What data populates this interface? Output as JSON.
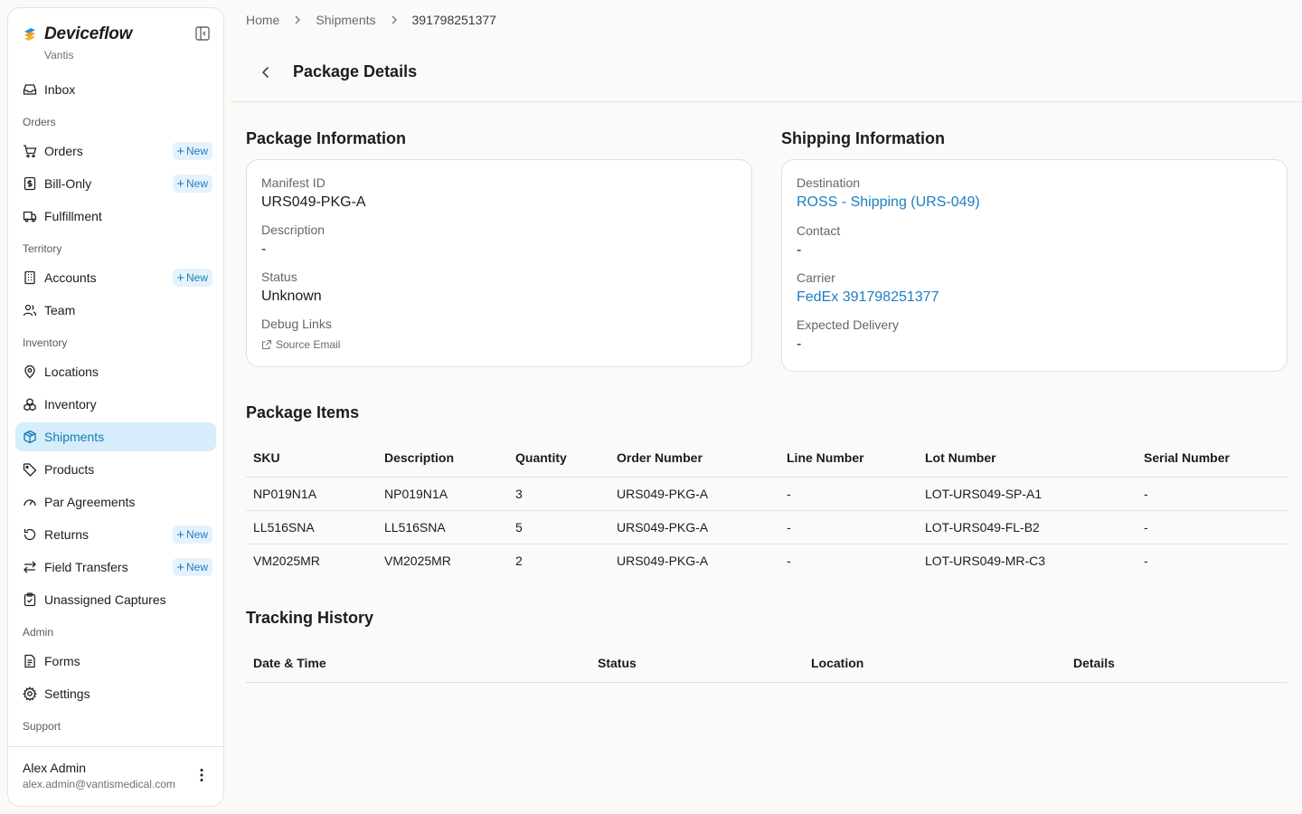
{
  "brand": {
    "name": "Deviceflow",
    "org": "Vantis"
  },
  "nav": {
    "inbox": "Inbox",
    "sections": {
      "orders": "Orders",
      "territory": "Territory",
      "inventory": "Inventory",
      "admin": "Admin",
      "support": "Support"
    },
    "items": {
      "orders": "Orders",
      "bill_only": "Bill-Only",
      "fulfillment": "Fulfillment",
      "accounts": "Accounts",
      "team": "Team",
      "locations": "Locations",
      "inventory": "Inventory",
      "shipments": "Shipments",
      "products": "Products",
      "par_agreements": "Par Agreements",
      "returns": "Returns",
      "field_transfers": "Field Transfers",
      "unassigned_captures": "Unassigned Captures",
      "forms": "Forms",
      "settings": "Settings"
    },
    "new_label": "New",
    "active": "Shipments"
  },
  "user": {
    "name": "Alex Admin",
    "email": "alex.admin@vantismedical.com"
  },
  "breadcrumb": {
    "home": "Home",
    "shipments": "Shipments",
    "current": "391798251377"
  },
  "page": {
    "title": "Package Details"
  },
  "package_info": {
    "title": "Package Information",
    "manifest_label": "Manifest ID",
    "manifest_value": "URS049-PKG-A",
    "description_label": "Description",
    "description_value": "-",
    "status_label": "Status",
    "status_value": "Unknown",
    "debug_label": "Debug Links",
    "source_email": "Source Email"
  },
  "shipping_info": {
    "title": "Shipping Information",
    "destination_label": "Destination",
    "destination_value": "ROSS - Shipping (URS-049)",
    "contact_label": "Contact",
    "contact_value": "-",
    "carrier_label": "Carrier",
    "carrier_value": "FedEx 391798251377",
    "delivery_label": "Expected Delivery",
    "delivery_value": "-"
  },
  "package_items": {
    "title": "Package Items",
    "columns": [
      "SKU",
      "Description",
      "Quantity",
      "Order Number",
      "Line Number",
      "Lot Number",
      "Serial Number"
    ],
    "rows": [
      [
        "NP019N1A",
        "NP019N1A",
        "3",
        "URS049-PKG-A",
        "-",
        "LOT-URS049-SP-A1",
        "-"
      ],
      [
        "LL516SNA",
        "LL516SNA",
        "5",
        "URS049-PKG-A",
        "-",
        "LOT-URS049-FL-B2",
        "-"
      ],
      [
        "VM2025MR",
        "VM2025MR",
        "2",
        "URS049-PKG-A",
        "-",
        "LOT-URS049-MR-C3",
        "-"
      ]
    ]
  },
  "tracking": {
    "title": "Tracking History",
    "columns": [
      "Date & Time",
      "Status",
      "Location",
      "Details"
    ]
  },
  "colors": {
    "accent": "#1b7fc2",
    "active_bg": "#d6eefb",
    "badge_bg": "#e6f2fb",
    "page_bg": "#fbfaf8"
  }
}
